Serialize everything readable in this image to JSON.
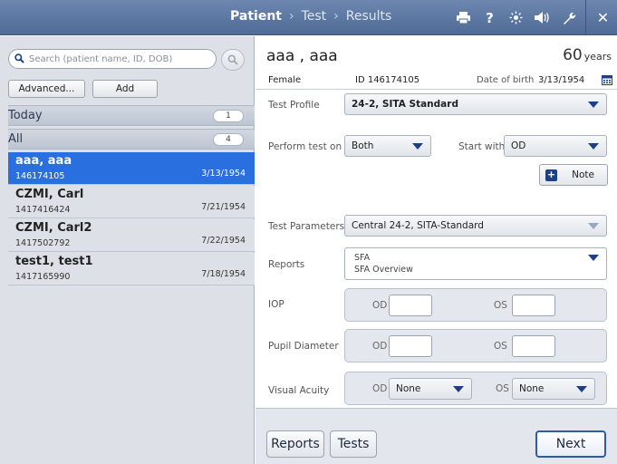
{
  "header": {
    "breadcrumb": [
      "Patient",
      "Test",
      "Results"
    ],
    "active_step": "Patient",
    "icons": [
      "printer-icon",
      "help-icon",
      "brightness-icon",
      "volume-icon",
      "wrench-icon",
      "close-icon"
    ]
  },
  "sidebar": {
    "search_placeholder": "Search (patient name, ID, DOB)",
    "advanced_label": "Advanced...",
    "add_label": "Add",
    "groups": [
      {
        "title": "Today",
        "count": "1"
      },
      {
        "title": "All",
        "count": "4"
      }
    ],
    "patients": [
      {
        "name": "aaa, aaa",
        "id": "146174105",
        "dob": "3/13/1954",
        "selected": true
      },
      {
        "name": "CZMI, Carl",
        "id": "1417416424",
        "dob": "7/21/1954",
        "selected": false
      },
      {
        "name": "CZMI, Carl2",
        "id": "1417502792",
        "dob": "7/22/1954",
        "selected": false
      },
      {
        "name": "test1, test1",
        "id": "1417165990",
        "dob": "7/18/1954",
        "selected": false
      }
    ]
  },
  "patient": {
    "name": "aaa , aaa",
    "age": "60",
    "age_unit": "years",
    "gender": "Female",
    "id_label": "ID 146174105",
    "dob_label": "Date of birth",
    "dob": "3/13/1954"
  },
  "form": {
    "test_profile_label": "Test Profile",
    "test_profile_value": "24-2, SITA Standard",
    "perform_label": "Perform test on",
    "perform_value": "Both",
    "start_label": "Start with",
    "start_value": "OD",
    "note_label": "Note",
    "test_params_label": "Test Parameters",
    "test_params_value": "Central 24-2, SITA-Standard",
    "reports_label": "Reports",
    "reports_values": [
      "SFA",
      "SFA Overview"
    ],
    "iop_label": "IOP",
    "pupil_label": "Pupil Diameter",
    "va_label": "Visual Acuity",
    "od_label": "OD",
    "os_label": "OS",
    "va_od_value": "None",
    "va_os_value": "None"
  },
  "footer": {
    "reports_label": "Reports",
    "tests_label": "Tests",
    "next_label": "Next"
  },
  "colors": {
    "header": "#5a76a3",
    "selection": "#2a6fe0",
    "accent": "#1d3f8a"
  }
}
